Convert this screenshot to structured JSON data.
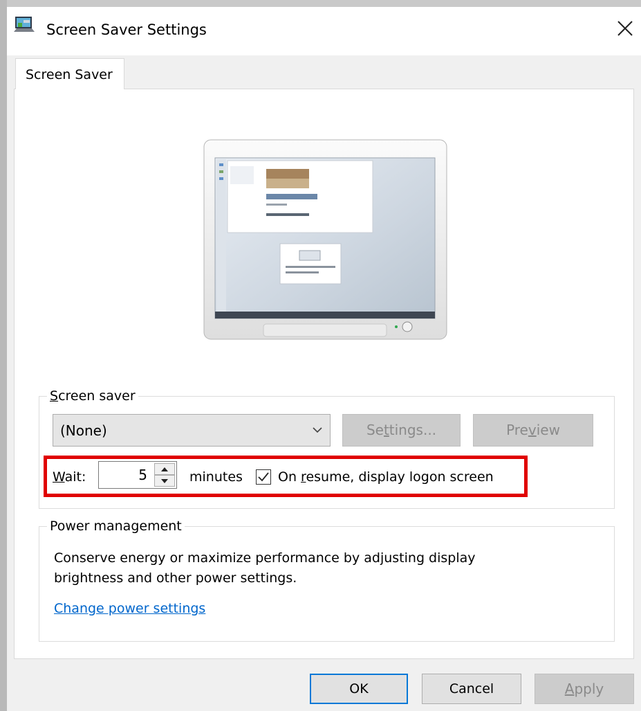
{
  "window": {
    "title": "Screen Saver Settings",
    "close_glyph": "✕"
  },
  "tabs": [
    {
      "label": "Screen Saver",
      "selected": true
    }
  ],
  "screen_saver": {
    "group_label_first": "S",
    "group_label_rest": "creen saver",
    "selected": "(None)",
    "settings_label_a": "Se",
    "settings_label_u": "t",
    "settings_label_b": "tings...",
    "preview_label_a": "Pre",
    "preview_label_u": "v",
    "preview_label_b": "iew",
    "wait_label_first": "W",
    "wait_label_rest": "ait:",
    "wait_value": "5",
    "minutes_label": "minutes",
    "resume_checked": true,
    "resume_label_a": "On ",
    "resume_label_u": "r",
    "resume_label_b": "esume, display logon screen"
  },
  "power": {
    "group_label": "Power management",
    "description_line1": "Conserve energy or maximize performance by adjusting display",
    "description_line2": "brightness and other power settings.",
    "link": "Change power settings"
  },
  "buttons": {
    "ok": "OK",
    "cancel": "Cancel",
    "apply_first": "A",
    "apply_rest": "pply"
  },
  "colors": {
    "highlight": "#e00000",
    "link": "#0066cc",
    "default_button_border": "#0078d7"
  },
  "icons": [
    "screensaver-app-icon",
    "close-icon",
    "chevron-down-icon",
    "spin-up-icon",
    "spin-down-icon",
    "checkmark-icon"
  ]
}
